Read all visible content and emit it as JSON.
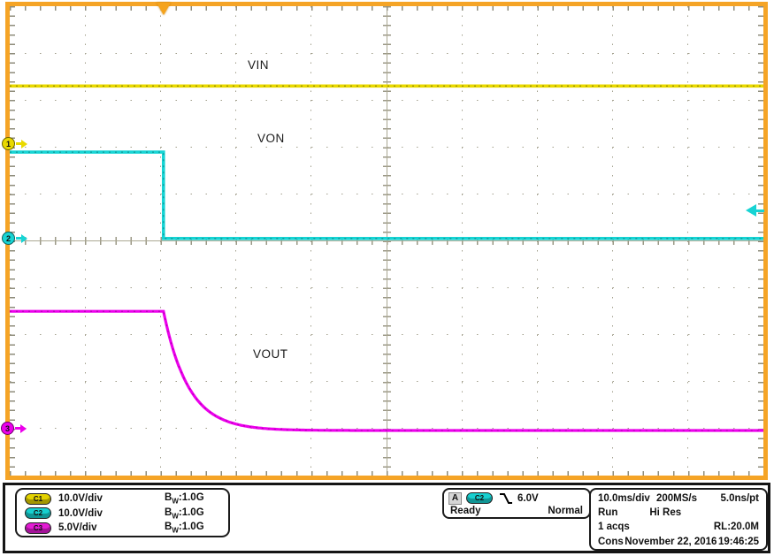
{
  "scope": {
    "trace_labels": {
      "vin": "VIN",
      "von": "VON",
      "vout": "VOUT"
    },
    "channel_markers": {
      "ch1": "1",
      "ch2": "2",
      "ch3": "3"
    },
    "colors": {
      "frame_orange": "#F5A426",
      "ch1_yellow": "#E9D900",
      "ch2_cyan": "#17D4D4",
      "ch3_magenta": "#EC00EC",
      "grid_gray": "#A3A08E",
      "readout_text": "#111111"
    }
  },
  "readouts": {
    "channels": [
      {
        "id": "C1",
        "scale": "10.0V/div",
        "bw_b": "B",
        "bw_w": "W",
        "bw_value": ":1.0G"
      },
      {
        "id": "C2",
        "scale": "10.0V/div",
        "bw_b": "B",
        "bw_w": "W",
        "bw_value": ":1.0G"
      },
      {
        "id": "C3",
        "scale": "5.0V/div",
        "bw_b": "B",
        "bw_w": "W",
        "bw_value": ":1.0G"
      }
    ],
    "trigger": {
      "bus": "A",
      "source": "C2",
      "slope": "falling-edge",
      "level": "6.0V",
      "state": "Ready",
      "mode": "Normal"
    },
    "timebase": {
      "scale": "10.0ms/div",
      "sample_rate": "200MS/s",
      "resolution": "5.0ns/pt",
      "run_state": "Run",
      "acq_mode": "Hi Res",
      "acq_count": "1 acqs",
      "record_length": "RL:20.0M",
      "prefix": "Cons",
      "date": "November 22, 2016",
      "time": "19:46:25"
    }
  },
  "chart_data": {
    "type": "line",
    "title": "Oscilloscope capture: VOUT shutdown when VON is driven low",
    "x_axis": {
      "scale": "10.0ms/div",
      "divisions": 10
    },
    "y_axis": {
      "divisions": 10
    },
    "trigger": {
      "position_div_x": 2.04,
      "level_div_y": 4.35,
      "source": "C2",
      "level": "6.0V"
    },
    "ground_refs_div_y": {
      "ch1": 2.94,
      "ch2": 4.95,
      "ch3": 9.0
    },
    "series": [
      {
        "name": "VIN",
        "channel": "C1",
        "volts_per_div": "10.0V",
        "approx_behavior": "constant ~12V across full record",
        "color": "#E9D900",
        "noise_color": "rgba(80,78,0,0.5)",
        "width": 3.6,
        "render": [
          {
            "poly": [
              [
                0,
                1.7
              ],
              [
                10,
                1.7
              ]
            ]
          }
        ]
      },
      {
        "name": "VON",
        "channel": "C2",
        "volts_per_div": "10.0V",
        "approx_behavior": "high until trigger at 2.04 div, then steps to 0V (ground ref)",
        "color": "#17D4D4",
        "noise_color": "rgba(0,80,80,0.45)",
        "width": 3.6,
        "render": [
          {
            "poly": [
              [
                0,
                3.11
              ],
              [
                2.04,
                3.11
              ],
              [
                2.04,
                4.95
              ],
              [
                10,
                4.95
              ]
            ]
          }
        ]
      },
      {
        "name": "VOUT",
        "channel": "C3",
        "volts_per_div": "5.0V",
        "approx_behavior": "~12.5V until trigger, then exponential decay to 0V (ground ref)",
        "color": "#EC00EC",
        "noise_color": "rgba(110,0,110,0.4)",
        "width": 3.2,
        "render": [
          {
            "poly": [
              [
                0,
                6.5
              ],
              [
                2.04,
                6.5
              ]
            ]
          },
          {
            "exp": {
              "x0": 2.04,
              "y0": 6.5,
              "yInf": 9.04,
              "tau": 0.33,
              "x1": 10
            }
          }
        ]
      }
    ]
  }
}
